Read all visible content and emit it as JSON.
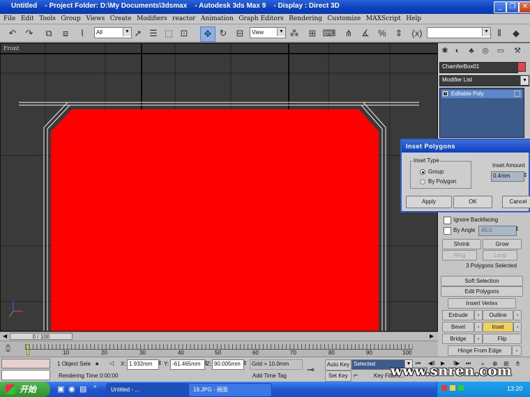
{
  "window": {
    "title": "Untitled    - Project Folder: D:\\My Documents\\3dsmax    - Autodesk 3ds Max 9    - Display : Direct 3D"
  },
  "menu": [
    "File",
    "Edit",
    "Tools",
    "Group",
    "Views",
    "Create",
    "Modifiers",
    "reactor",
    "Animation",
    "Graph Editors",
    "Rendering",
    "Customize",
    "MAXScript",
    "Help"
  ],
  "toolbar": {
    "selection_filter": "All",
    "ref_coord": "View"
  },
  "viewport": {
    "label": "Front",
    "object_color": "#ff0000"
  },
  "command_panel": {
    "object_name": "ChamferBox01",
    "object_color": "#e04848",
    "modifier_list_label": "Modifier List",
    "stack_item": "Editable Poly",
    "ignore_backfacing": "Ignore Backfacing",
    "by_angle": "By Angle",
    "by_angle_value": "45.0",
    "shrink": "Shrink",
    "grow": "Grow",
    "ring": "Ring",
    "loop": "Loop",
    "selection_status": "3 Polygons Selected",
    "soft_selection": "Soft Selection",
    "edit_polygons": "Edit Polygons",
    "insert_vertex": "Insert Vertex",
    "extrude": "Extrude",
    "outline": "Outline",
    "bevel": "Bevel",
    "inset": "Inset",
    "bridge": "Bridge",
    "flip": "Flip",
    "hinge": "Hinge From Edge"
  },
  "dialog": {
    "title": "Inset Polygons",
    "inset_type_label": "Inset Type",
    "option_group": "Group",
    "option_by_polygon": "By Polygon",
    "amount_label": "Inset Amount",
    "amount_value": "0.4mm",
    "apply": "Apply",
    "ok": "OK",
    "cancel": "Cancel"
  },
  "timeline": {
    "frame": "0 / 100",
    "ticks": [
      "10",
      "20",
      "30",
      "40",
      "50",
      "60",
      "70",
      "80",
      "90",
      "100"
    ]
  },
  "status": {
    "selection": "1 Object Sele",
    "x_label": "X:",
    "x": "1.932mm",
    "y_label": "Y:",
    "y": "-61.465mm",
    "z_label": "Z:",
    "z": "90.005mm",
    "grid": "Grid = 10.0mm",
    "autokey": "Auto Key",
    "autokey_mode": "Selected",
    "setkey": "Set Key",
    "key_filters": "Key Filters...",
    "rendering_time": "Rendering Time 0:00:00",
    "add_time_tag": "Add Time Tag"
  },
  "taskbar": {
    "start": "开始",
    "task1": "Untitled      - ...",
    "task2": "19.JPG - 画图",
    "clock": "13:20"
  },
  "watermark": "www.snren.com"
}
